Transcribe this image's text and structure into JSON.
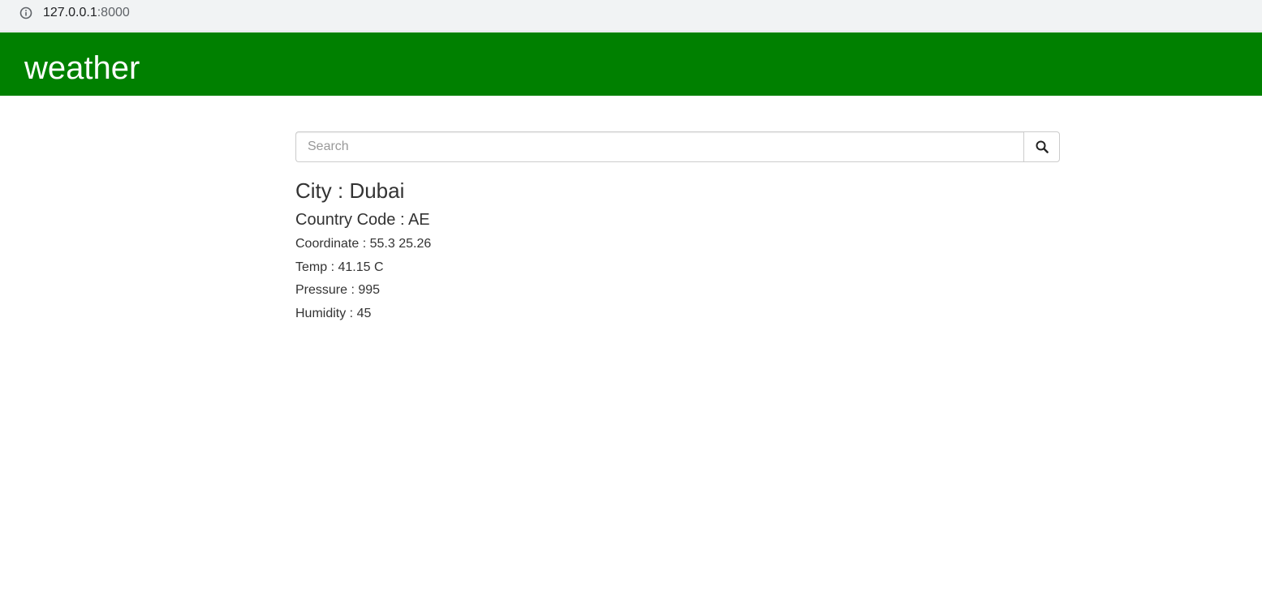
{
  "browser": {
    "url_host": "127.0.0.1",
    "url_port": ":8000",
    "info_icon": "info-icon"
  },
  "navbar": {
    "brand": "weather",
    "background_color": "#008000"
  },
  "search": {
    "placeholder": "Search",
    "value": "",
    "button_icon": "search-icon"
  },
  "weather": {
    "city": "City : Dubai",
    "country": "Country Code : AE",
    "coordinate": "Coordinate : 55.3 25.26",
    "temp": "Temp : 41.15 C",
    "pressure": "Pressure : 995",
    "humidity": "Humidity : 45"
  }
}
